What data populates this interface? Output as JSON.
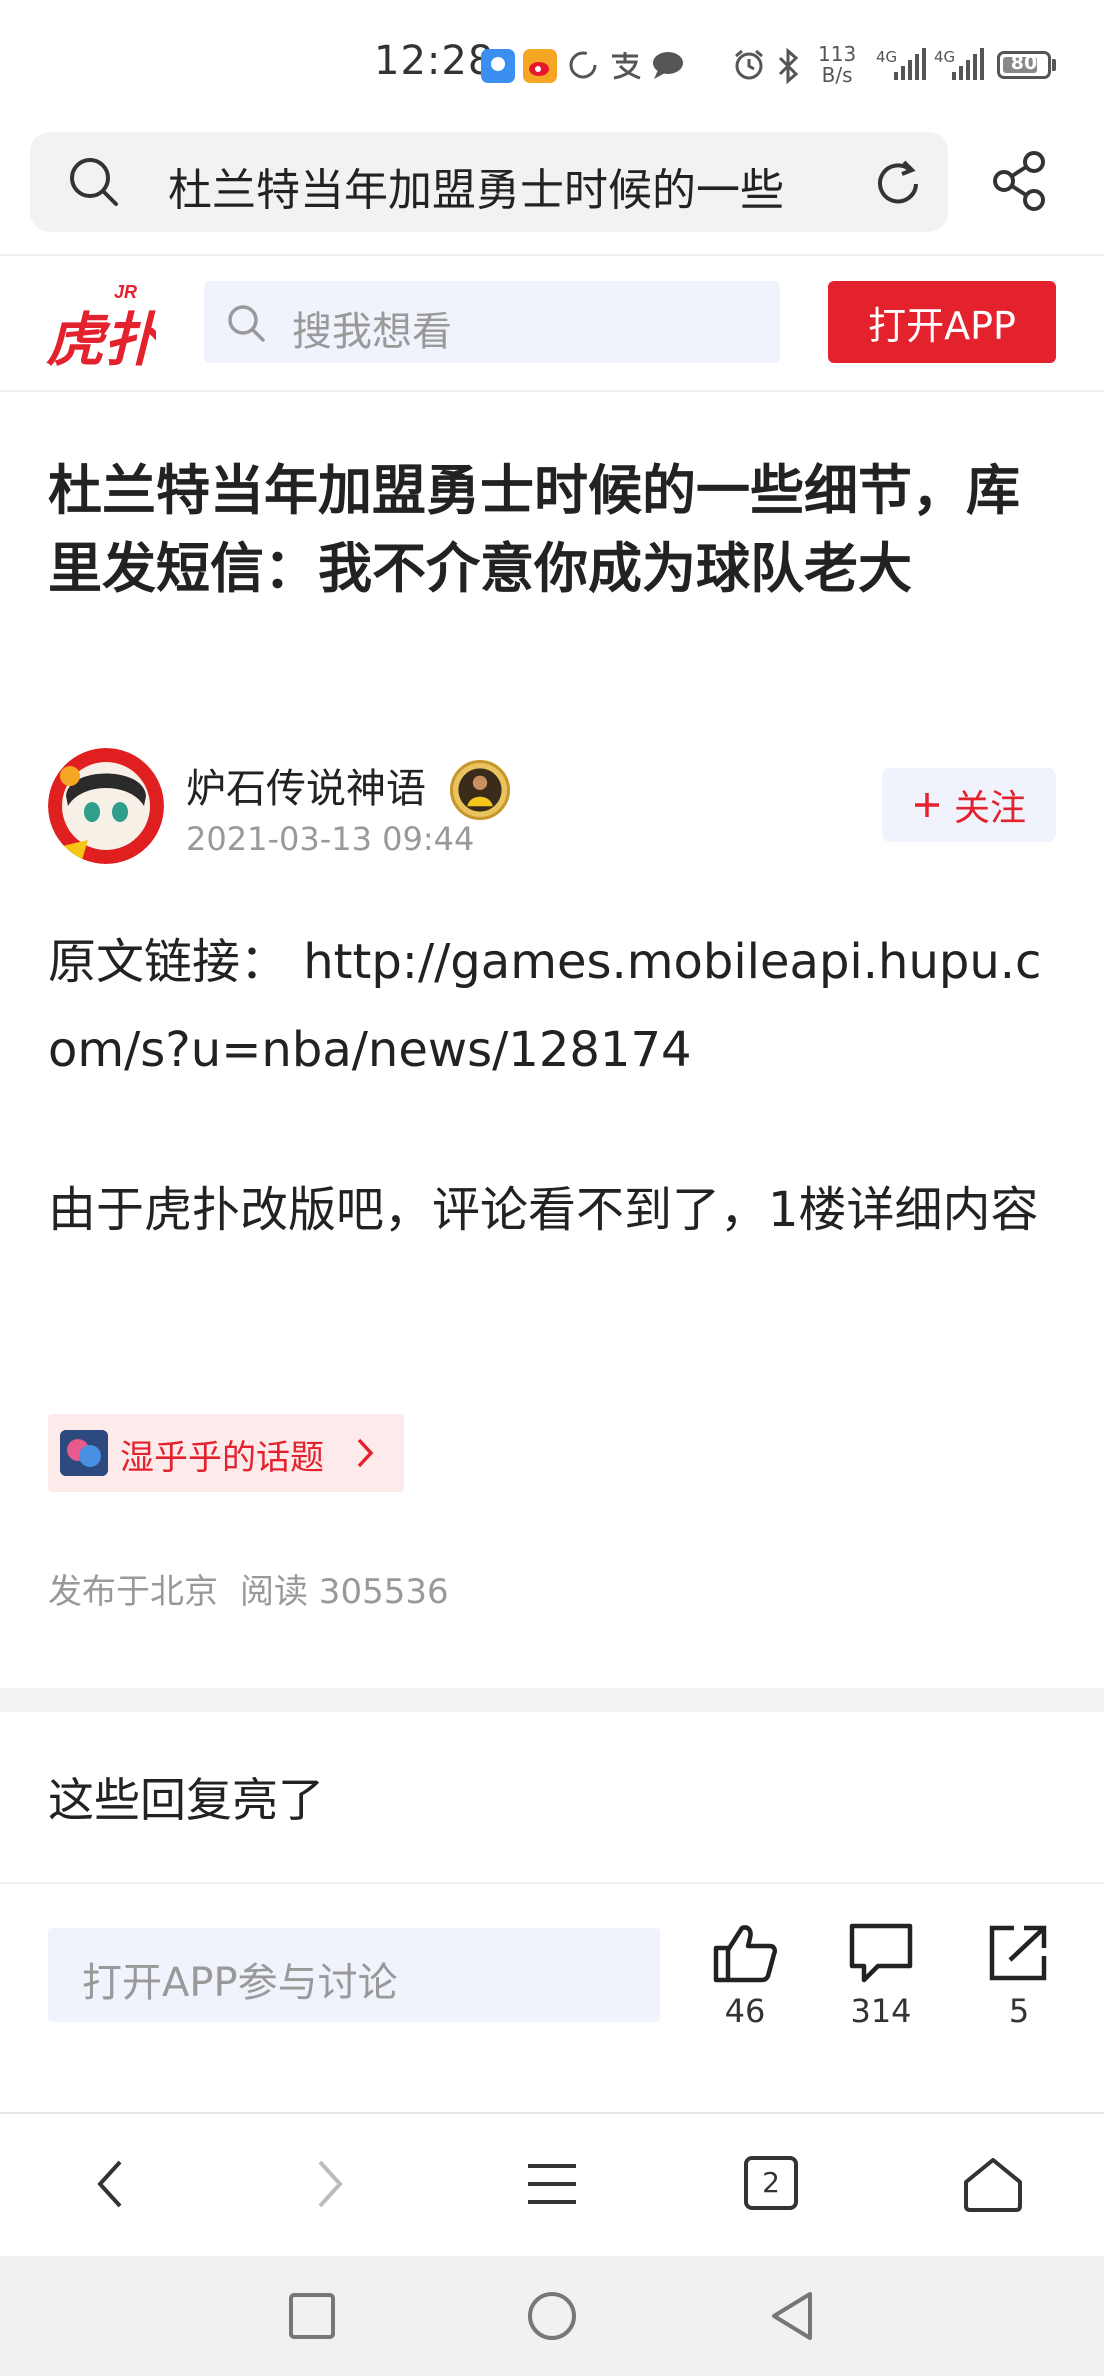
{
  "status_bar": {
    "time": "12:28",
    "net_speed": "113\nB/s",
    "net1": "4G",
    "net2": "4G",
    "battery_level": 80,
    "battery_text": "80",
    "icons": [
      "weather-icon",
      "weibo-icon",
      "loading-icon",
      "alipay-icon",
      "chat-icon",
      "alarm-icon",
      "bluetooth-icon",
      "signal-icon",
      "signal-icon",
      "battery-icon"
    ]
  },
  "browser": {
    "address_text": "杜兰特当年加盟勇士时候的一些",
    "tab_count": "2"
  },
  "site_header": {
    "logo_text": "虎扑",
    "logo_sup": "JR",
    "search_placeholder": "搜我想看",
    "open_app_label": "打开APP"
  },
  "article": {
    "title": "杜兰特当年加盟勇士时候的一些细节，库里发短信：我不介意你成为球队老大",
    "author": "炉石传说神语",
    "time": "2021-03-13 09:44",
    "follow_label": "关注",
    "paragraphs": [
      "原文链接：  http://games.mobileapi.hupu.com/s?u=nba/news/128174",
      "由于虎扑改版吧，评论看不到了，1楼详细内容"
    ],
    "topic": "湿乎乎的话题",
    "location": "发布于北京",
    "reads": "阅读 305536"
  },
  "hot_replies": {
    "title": "这些回复亮了"
  },
  "action_bar": {
    "placeholder": "打开APP参与讨论",
    "likes": "46",
    "comments": "314",
    "shares": "5"
  },
  "colors": {
    "brand_red": "#e4222e",
    "light_bg": "#f0f3fb"
  }
}
